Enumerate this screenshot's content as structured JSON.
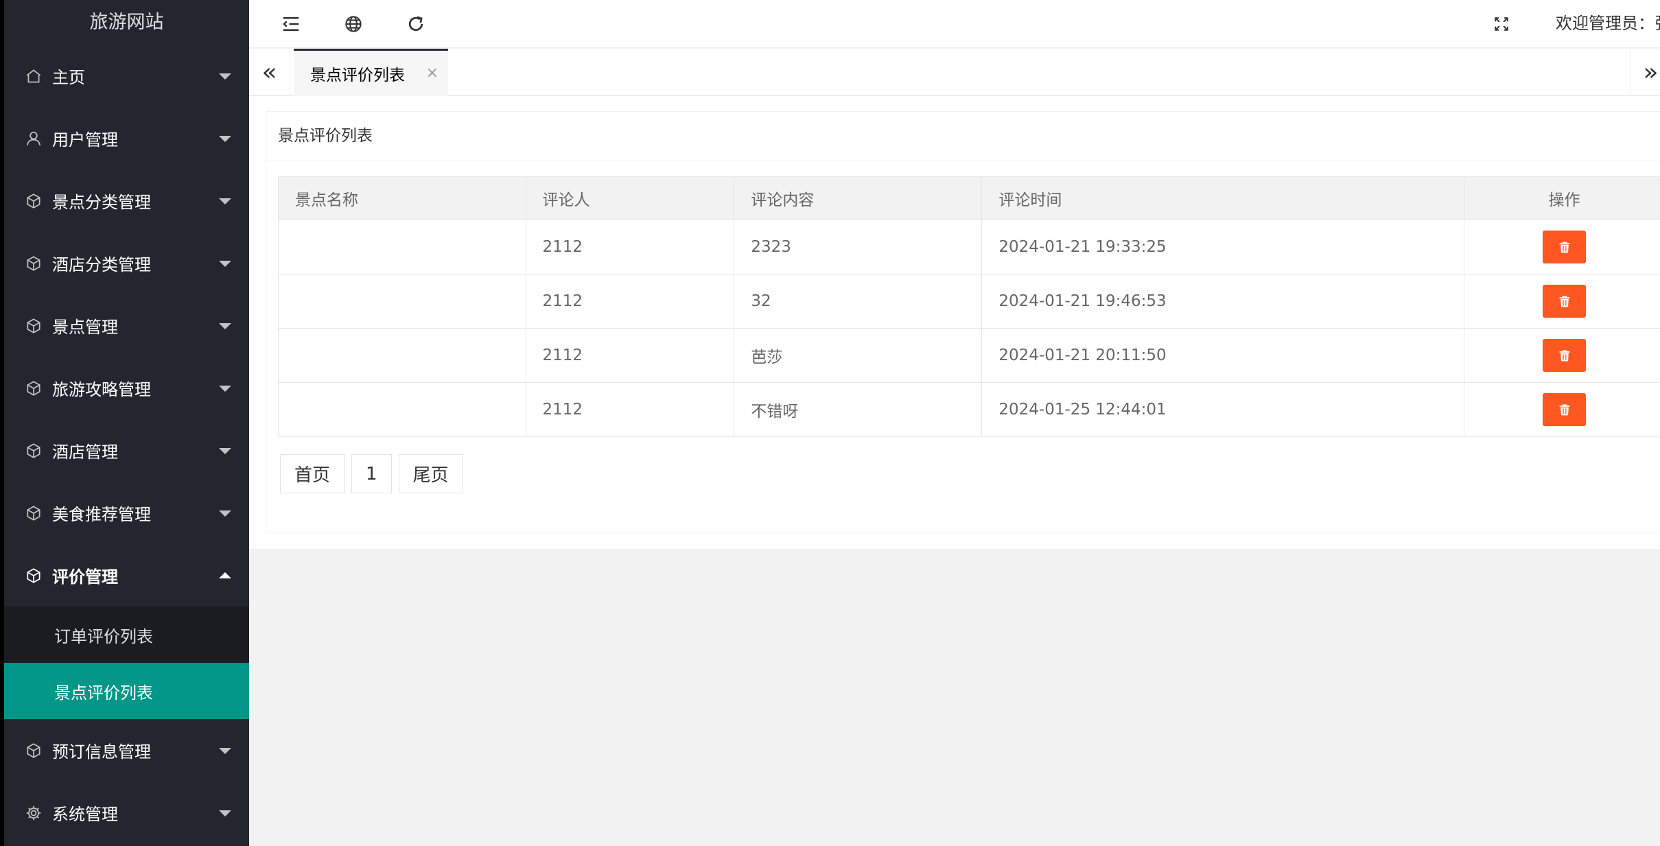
{
  "app_title": "旅游网站",
  "sidebar": {
    "items": [
      {
        "label": "主页",
        "icon": "home-icon"
      },
      {
        "label": "用户管理",
        "icon": "user-icon"
      },
      {
        "label": "景点分类管理",
        "icon": "cube-icon"
      },
      {
        "label": "酒店分类管理",
        "icon": "cube-icon"
      },
      {
        "label": "景点管理",
        "icon": "cube-icon"
      },
      {
        "label": "旅游攻略管理",
        "icon": "cube-icon"
      },
      {
        "label": "酒店管理",
        "icon": "cube-icon"
      },
      {
        "label": "美食推荐管理",
        "icon": "cube-icon"
      },
      {
        "label": "评价管理",
        "icon": "cube-icon",
        "expanded": true
      },
      {
        "label": "预订信息管理",
        "icon": "cube-icon"
      },
      {
        "label": "系统管理",
        "icon": "gear-icon"
      }
    ],
    "sub_items": [
      {
        "label": "订单评价列表"
      },
      {
        "label": "景点评价列表",
        "active": true
      }
    ]
  },
  "header": {
    "icons": [
      "indent-icon",
      "globe-icon",
      "refresh-icon",
      "fullscreen-icon"
    ],
    "welcome": "欢迎管理员：张"
  },
  "tabs": {
    "active_tab": "景点评价列表",
    "close_glyph": "×",
    "nav_left": "«",
    "nav_right": "»"
  },
  "panel": {
    "title": "景点评价列表"
  },
  "table": {
    "headers": [
      "景点名称",
      "评论人",
      "评论内容",
      "评论时间",
      "操作"
    ],
    "rows": [
      {
        "spot": "",
        "user": "2112",
        "content": "2323",
        "time": "2024-01-21 19:33:25"
      },
      {
        "spot": "",
        "user": "2112",
        "content": "32",
        "time": "2024-01-21 19:46:53"
      },
      {
        "spot": "",
        "user": "2112",
        "content": "芭莎",
        "time": "2024-01-21 20:11:50"
      },
      {
        "spot": "",
        "user": "2112",
        "content": "不错呀",
        "time": "2024-01-25 12:44:01"
      }
    ],
    "delete_icon": "trash-icon"
  },
  "pager": {
    "first": "首页",
    "page": "1",
    "last": "尾页"
  },
  "colors": {
    "sidebar_bg": "#23262e",
    "active_green": "#009688",
    "danger": "#ff5722"
  }
}
